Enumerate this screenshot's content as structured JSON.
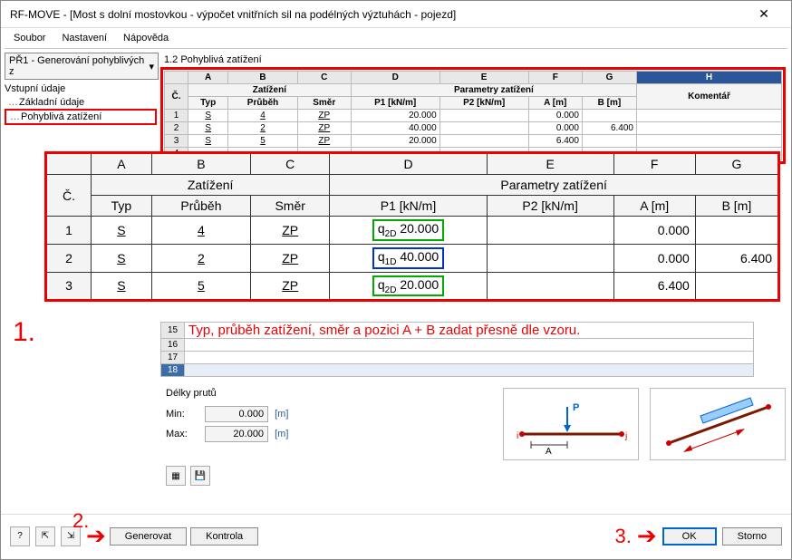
{
  "window": {
    "title": "RF-MOVE - [Most s dolní mostovkou - výpočet vnitřních sil na podélných výztuhách - pojezd]"
  },
  "menu": {
    "file": "Soubor",
    "settings": "Nastavení",
    "help": "Nápověda"
  },
  "case_selector": "PŘ1 - Generování pohyblivých z",
  "left": {
    "heading": "Vstupní údaje",
    "item_basic": "Základní údaje",
    "item_moving": "Pohyblivá zatížení"
  },
  "panel_title": "1.2 Pohyblivá zatížení",
  "cols": {
    "a": "A",
    "b": "B",
    "c": "C",
    "d": "D",
    "e": "E",
    "f": "F",
    "g": "G",
    "h": "H",
    "num": "Č."
  },
  "groups": {
    "load": "Zatížení",
    "params": "Parametry zatížení"
  },
  "headers": {
    "typ": "Typ",
    "prubeh": "Průběh",
    "smer": "Směr",
    "p1": "P1 [kN/m]",
    "p2": "P2 [kN/m]",
    "a": "A [m]",
    "b": "B [m]",
    "komentar": "Komentář"
  },
  "small_rows": {
    "r1": {
      "n": "1",
      "typ": "S",
      "prubeh": "4",
      "smer": "ZP",
      "p1": "20.000",
      "p2": "",
      "a": "0.000",
      "b": ""
    },
    "r2": {
      "n": "2",
      "typ": "S",
      "prubeh": "2",
      "smer": "ZP",
      "p1": "40.000",
      "p2": "",
      "a": "0.000",
      "b": "6.400"
    },
    "r3": {
      "n": "3",
      "typ": "S",
      "prubeh": "5",
      "smer": "ZP",
      "p1": "20.000",
      "p2": "",
      "a": "6.400",
      "b": ""
    },
    "r4": {
      "n": "4"
    }
  },
  "big_rows": {
    "r1": {
      "n": "1",
      "typ": "S",
      "prubeh": "4",
      "smer": "ZP",
      "q": "q",
      "sub": "2D",
      "p1": "20.000",
      "a": "0.000",
      "b": ""
    },
    "r2": {
      "n": "2",
      "typ": "S",
      "prubeh": "2",
      "smer": "ZP",
      "q": "q",
      "sub": "1D",
      "p1": "40.000",
      "a": "0.000",
      "b": "6.400"
    },
    "r3": {
      "n": "3",
      "typ": "S",
      "prubeh": "5",
      "smer": "ZP",
      "q": "q",
      "sub": "2D",
      "p1": "20.000",
      "a": "6.400",
      "b": ""
    }
  },
  "blank_row_nums": {
    "r15": "15",
    "r16": "16",
    "r17": "17",
    "r18": "18"
  },
  "annotations": {
    "one": "1.",
    "two": "2.",
    "three": "3.",
    "instruction": "Typ, průběh zatížení, směr a pozici A + B zadat přesně dle vzoru."
  },
  "lengths": {
    "title": "Délky prutů",
    "min_lab": "Min:",
    "min_val": "0.000",
    "max_lab": "Max:",
    "max_val": "20.000",
    "unit": "[m]"
  },
  "diagram_labels": {
    "p": "P",
    "i": "i",
    "j": "j",
    "a": "A"
  },
  "buttons": {
    "generate": "Generovat",
    "check": "Kontrola",
    "ok": "OK",
    "cancel": "Storno"
  }
}
